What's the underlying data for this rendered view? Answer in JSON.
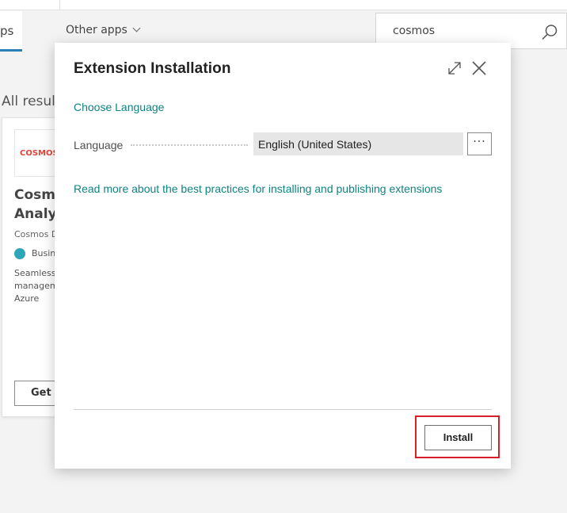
{
  "background": {
    "tab_apps_label": "ps",
    "other_apps_label": "Other apps",
    "search_value": "cosmos",
    "all_results_label": "All result",
    "card": {
      "logo_text": "COSMOS",
      "title_line1": "Cosmo",
      "title_line2": "Analyt",
      "publisher": "Cosmos D",
      "category": "Busin",
      "desc_line1": "Seamless",
      "desc_line2": "managem",
      "desc_line3": "Azure",
      "get_label": "Get i"
    }
  },
  "dialog": {
    "title": "Extension Installation",
    "choose_language_link": "Choose Language",
    "language_label": "Language",
    "language_value": "English (United States)",
    "lookup_label": "···",
    "read_more_link": "Read more about the best practices for installing and publishing extensions",
    "install_label": "Install"
  },
  "colors": {
    "link": "#0f8481",
    "tab_accent": "#2b7fb5",
    "highlight": "#d7202a"
  }
}
